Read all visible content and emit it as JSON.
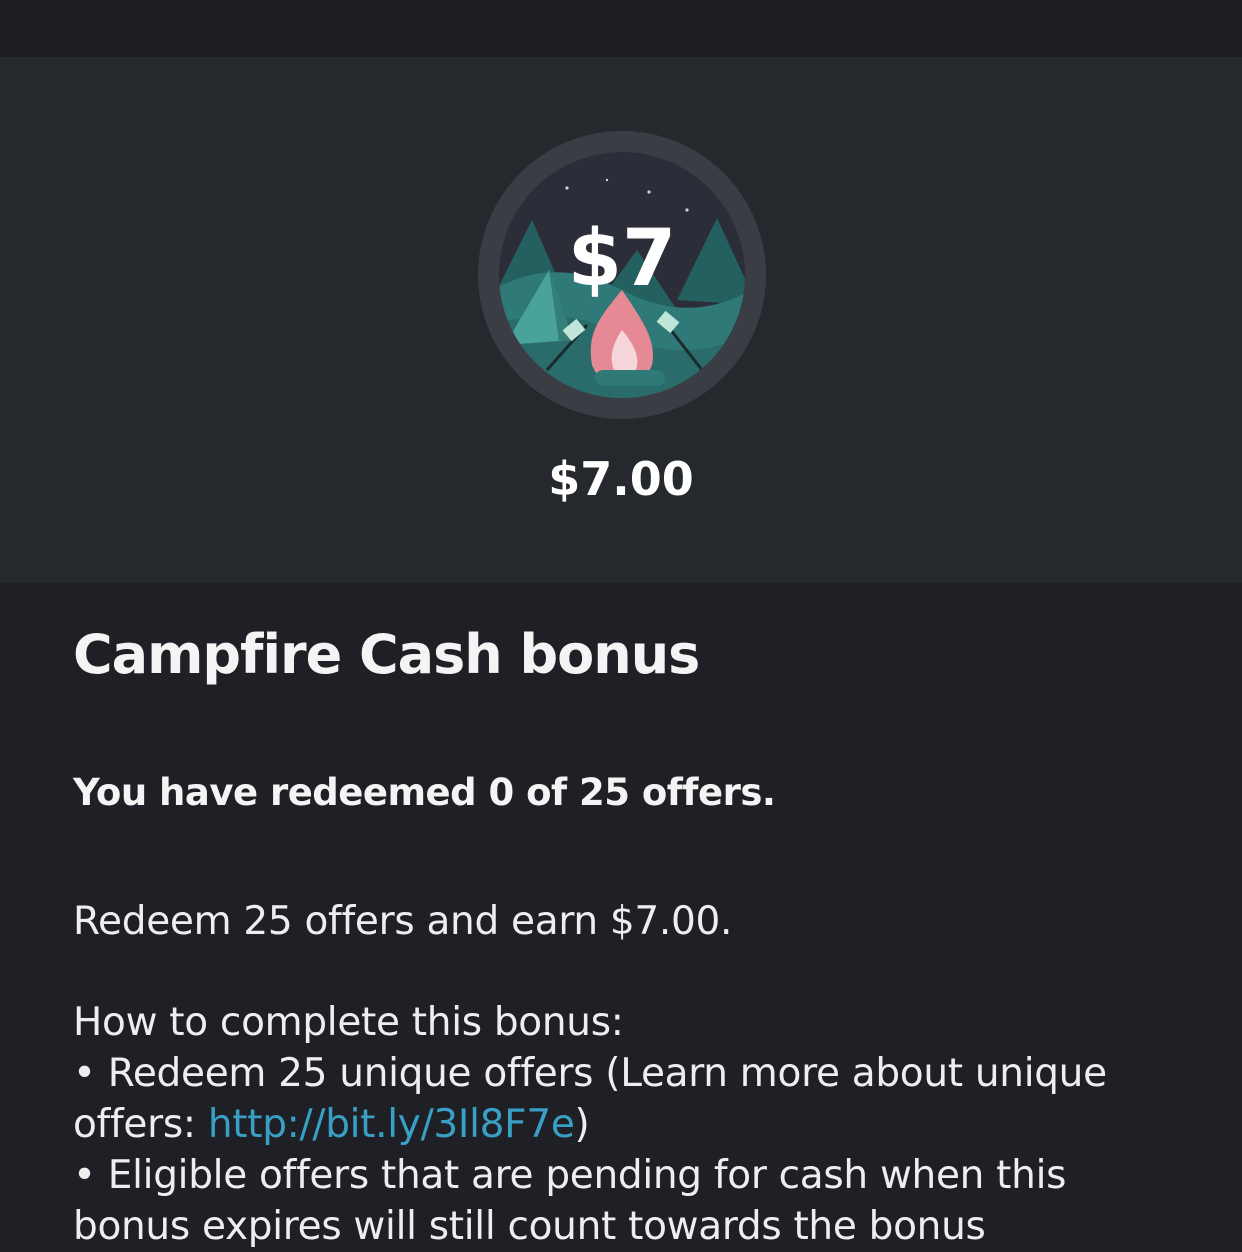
{
  "hero": {
    "badge_amount": "$7",
    "amount": "$7.00",
    "colors": {
      "background": "#25282d",
      "badge_ring": "#3a3d44",
      "night_sky": "#2b2e38",
      "trees": "#2f7a78",
      "flame": "#e58a94"
    }
  },
  "bonus": {
    "title": "Campfire Cash bonus",
    "progress_text": "You have redeemed 0 of 25 offers.",
    "summary": "Redeem 25 offers and earn $7.00.",
    "howto_heading": "How to complete this bonus:",
    "bullet1_part1": "• Redeem 25 unique offers (Learn more about unique",
    "bullet1_part2": "offers: ",
    "bullet1_link": "http://bit.ly/3Il8F7e",
    "bullet1_part3": ")",
    "bullet2_line1": "• Eligible offers that are pending for cash when this",
    "bullet2_line2": "bonus expires will still count towards the bonus"
  }
}
